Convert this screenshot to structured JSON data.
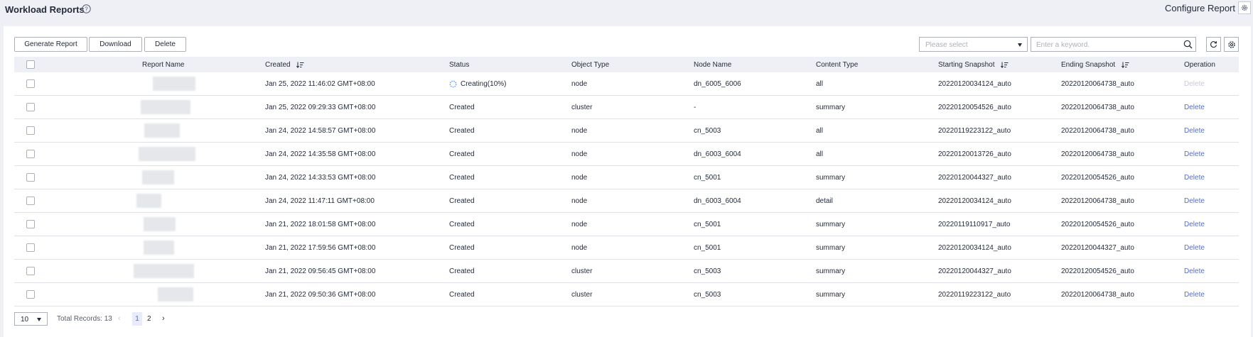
{
  "header": {
    "title": "Workload Reports",
    "configure_label": "Configure Report"
  },
  "toolbar": {
    "generate_label": "Generate Report",
    "download_label": "Download",
    "delete_label": "Delete",
    "select_placeholder": "Please select",
    "search_placeholder": "Enter a keyword."
  },
  "table": {
    "columns": {
      "report_name": "Report Name",
      "created": "Created",
      "status": "Status",
      "object_type": "Object Type",
      "node_name": "Node Name",
      "content_type": "Content Type",
      "starting_snapshot": "Starting Snapshot",
      "ending_snapshot": "Ending Snapshot",
      "operation": "Operation"
    },
    "rows": [
      {
        "created": "Jan 25, 2022 11:46:02 GMT+08:00",
        "status": "Creating(10%)",
        "object_type": "node",
        "node_name": "dn_6005_6006",
        "content_type": "all",
        "starting_snapshot": "20220120034124_auto",
        "ending_snapshot": "20220120064738_auto",
        "operation": "Delete"
      },
      {
        "created": "Jan 25, 2022 09:29:33 GMT+08:00",
        "status": "Created",
        "object_type": "cluster",
        "node_name": "-",
        "content_type": "summary",
        "starting_snapshot": "20220120054526_auto",
        "ending_snapshot": "20220120064738_auto",
        "operation": "Delete"
      },
      {
        "created": "Jan 24, 2022 14:58:57 GMT+08:00",
        "status": "Created",
        "object_type": "node",
        "node_name": "cn_5003",
        "content_type": "all",
        "starting_snapshot": "20220119223122_auto",
        "ending_snapshot": "20220120064738_auto",
        "operation": "Delete"
      },
      {
        "created": "Jan 24, 2022 14:35:58 GMT+08:00",
        "status": "Created",
        "object_type": "node",
        "node_name": "dn_6003_6004",
        "content_type": "all",
        "starting_snapshot": "20220120013726_auto",
        "ending_snapshot": "20220120064738_auto",
        "operation": "Delete"
      },
      {
        "created": "Jan 24, 2022 14:33:53 GMT+08:00",
        "status": "Created",
        "object_type": "node",
        "node_name": "cn_5001",
        "content_type": "summary",
        "starting_snapshot": "20220120044327_auto",
        "ending_snapshot": "20220120054526_auto",
        "operation": "Delete"
      },
      {
        "created": "Jan 24, 2022 11:47:11 GMT+08:00",
        "status": "Created",
        "object_type": "node",
        "node_name": "dn_6003_6004",
        "content_type": "detail",
        "starting_snapshot": "20220120034124_auto",
        "ending_snapshot": "20220120064738_auto",
        "operation": "Delete"
      },
      {
        "created": "Jan 21, 2022 18:01:58 GMT+08:00",
        "status": "Created",
        "object_type": "node",
        "node_name": "cn_5001",
        "content_type": "summary",
        "starting_snapshot": "20220119110917_auto",
        "ending_snapshot": "20220120054526_auto",
        "operation": "Delete"
      },
      {
        "created": "Jan 21, 2022 17:59:56 GMT+08:00",
        "status": "Created",
        "object_type": "node",
        "node_name": "cn_5001",
        "content_type": "summary",
        "starting_snapshot": "20220120034124_auto",
        "ending_snapshot": "20220120044327_auto",
        "operation": "Delete"
      },
      {
        "created": "Jan 21, 2022 09:56:45 GMT+08:00",
        "status": "Created",
        "object_type": "cluster",
        "node_name": "cn_5003",
        "content_type": "summary",
        "starting_snapshot": "20220120044327_auto",
        "ending_snapshot": "20220120054526_auto",
        "operation": "Delete"
      },
      {
        "created": "Jan 21, 2022 09:50:36 GMT+08:00",
        "status": "Created",
        "object_type": "cluster",
        "node_name": "cn_5003",
        "content_type": "summary",
        "starting_snapshot": "20220119223122_auto",
        "ending_snapshot": "20220120064738_auto",
        "operation": "Delete"
      }
    ]
  },
  "pagination": {
    "page_size": "10",
    "total_label": "Total Records: 13",
    "current_page": "1",
    "page_2": "2",
    "prev_arrow": "‹",
    "next_arrow": "›"
  },
  "colors": {
    "link": "#526ecc",
    "disabled": "#c7cbd4",
    "header_bg": "#eef0f5"
  }
}
